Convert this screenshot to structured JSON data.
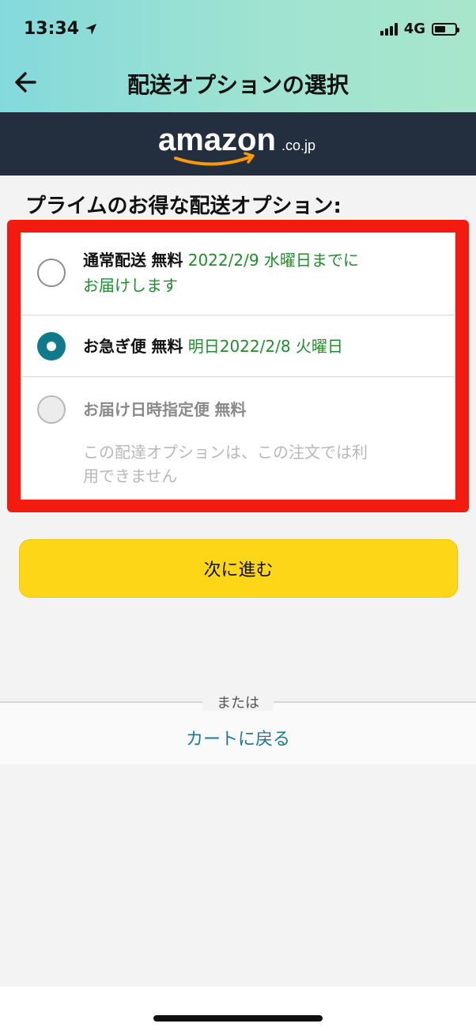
{
  "status": {
    "time": "13:34",
    "network": "4G"
  },
  "header": {
    "title": "配送オプションの選択"
  },
  "brand": {
    "logo_text": "amazon",
    "logo_suffix": ".co.jp"
  },
  "section": {
    "heading": "プライムのお得な配送オプション:"
  },
  "options": [
    {
      "name": "通常配送",
      "price": "無料",
      "date_line1": "2022/2/9 水曜日までに",
      "date_line2": "お届けします",
      "selected": false,
      "disabled": false
    },
    {
      "name": "お急ぎ便",
      "price": "無料",
      "date_line1": "明日2022/2/8 火曜日",
      "selected": true,
      "disabled": false
    },
    {
      "name": "お届け日時指定便",
      "price": "無料",
      "note_line1": "この配達オプションは、この注文では利",
      "note_line2": "用できません",
      "selected": false,
      "disabled": true
    }
  ],
  "actions": {
    "next_label": "次に進む",
    "or_label": "または",
    "back_to_cart": "カートに戻る"
  },
  "colors": {
    "accent_teal": "#0e7a8c",
    "button_yellow": "#fdd618",
    "date_green": "#1c8f2a",
    "highlight_red": "#f31a10",
    "brand_dark": "#232f3e"
  }
}
